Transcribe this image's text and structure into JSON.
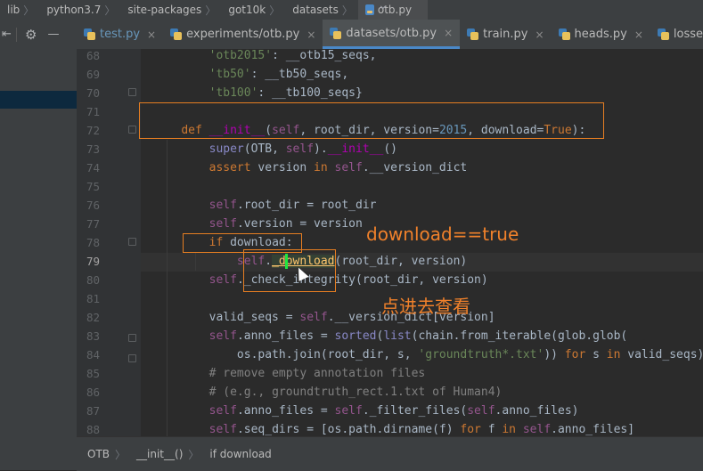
{
  "breadcrumb": {
    "items": [
      "lib",
      "python3.7",
      "site-packages",
      "got10k",
      "datasets",
      "otb.py"
    ]
  },
  "left_toolbar": {
    "minus_label": "—"
  },
  "tabs": [
    {
      "label": "test.py",
      "active": false,
      "muted": true
    },
    {
      "label": "experiments/otb.py",
      "active": false,
      "muted": false
    },
    {
      "label": "datasets/otb.py",
      "active": true,
      "muted": false
    },
    {
      "label": "train.py",
      "active": false,
      "muted": false
    },
    {
      "label": "heads.py",
      "active": false,
      "muted": false
    },
    {
      "label": "losses.py",
      "active": false,
      "muted": false
    }
  ],
  "editor": {
    "line_numbers": [
      "68",
      "69",
      "70",
      "71",
      "72",
      "73",
      "74",
      "75",
      "76",
      "77",
      "78",
      "79",
      "80",
      "81",
      "82",
      "83",
      "84",
      "85",
      "86",
      "87",
      "88"
    ],
    "current_line": "79"
  },
  "annotations": {
    "download_true": "download==true",
    "click_into": "点进去查看"
  },
  "statusbar": {
    "items": [
      "OTB",
      "__init__()",
      "if download"
    ]
  },
  "colors": {
    "annotation": "#f0812b",
    "box_border": "#e67e22",
    "accent_tab": "#4a88c7"
  }
}
